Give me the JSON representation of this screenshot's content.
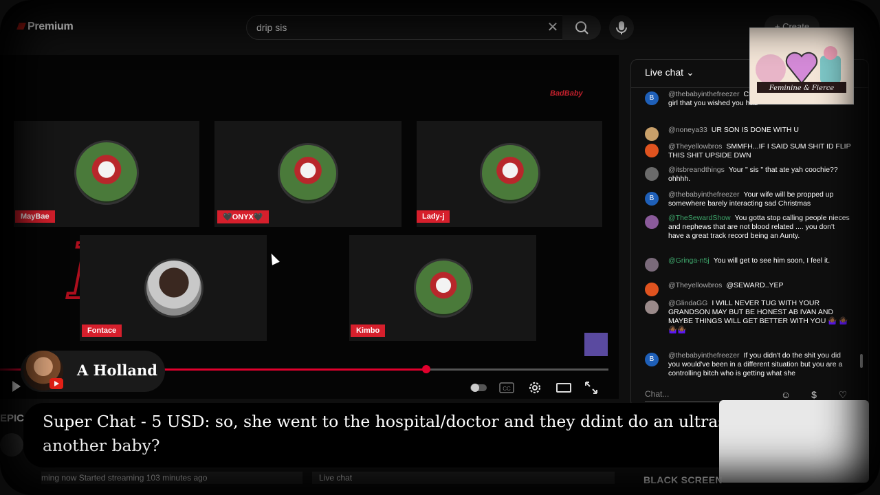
{
  "topbar": {
    "logo_label": "Premium",
    "search_value": "drip sis",
    "create_label": "+ Create"
  },
  "video": {
    "watermark": "BadBaby",
    "background_word": "Ba",
    "participants": [
      {
        "name": "MayBae"
      },
      {
        "name": "🖤ONYX🖤"
      },
      {
        "name": "Lady-j"
      },
      {
        "name": "Fontace"
      },
      {
        "name": "Kimbo"
      }
    ],
    "progress": 0.7
  },
  "channel": {
    "name": "A Holland"
  },
  "chat": {
    "header": "Live chat",
    "input_placeholder": "Chat...",
    "messages": [
      {
        "avatar": "B",
        "avatar_color": "#1e5fb8",
        "user": "@thebabyinthefreezer",
        "text": "Christmas with his beautiful baby girl that you wished you had",
        "verified": false
      },
      {
        "avatar": "",
        "avatar_color": "#c9a06a",
        "user": "@noneya33",
        "text": "UR SON IS DONE WITH U",
        "verified": false
      },
      {
        "avatar": "",
        "avatar_color": "#e0531f",
        "user": "@Theyellowbros",
        "text": "SMMFH...IF I SAID SUM SHIT ID FLIP THIS SHIT UPSIDE DWN",
        "verified": false
      },
      {
        "avatar": "",
        "avatar_color": "#6a6a6a",
        "user": "@itsbreandthings",
        "text": "Your \" sis \" that ate yah coochie?? ohhhh.",
        "verified": false
      },
      {
        "avatar": "B",
        "avatar_color": "#1e5fb8",
        "user": "@thebabyinthefreezer",
        "text": "Your wife will be propped up somewhere barely interacting sad Christmas",
        "verified": false
      },
      {
        "avatar": "",
        "avatar_color": "#8a5a9a",
        "user": "@TheSewardShow",
        "text": "You gotta stop calling people nieces and nephews that are not blood related .... you don't have a great track record being an Aunty.",
        "verified": true
      },
      {
        "avatar": "",
        "avatar_color": "#7a6a7a",
        "user": "@Gringa-n5j",
        "text": "You will get to see him soon, I feel it.",
        "verified": true
      },
      {
        "avatar": "",
        "avatar_color": "#e0531f",
        "user": "@Theyellowbros",
        "text": "@SEWARD..YEP",
        "verified": false
      },
      {
        "avatar": "",
        "avatar_color": "#9a8a8a",
        "user": "@GlindaGG",
        "text": "I WILL NEVER TUG WITH YOUR GRANDSON MAY BUT BE HONEST AB IVAN AND MAYBE THINGS WILL GET BETTER WITH YOU 🤷🏾‍♀️ 🤷🏾‍♀️🤷🏾‍♀️🤷🏾‍♀️",
        "verified": false
      },
      {
        "avatar": "B",
        "avatar_color": "#1e5fb8",
        "user": "@thebabyinthefreezer",
        "text": "If you didn't do the shit you did you would've been in a different situation but you are a controlling bitch who is getting what she",
        "verified": false
      }
    ]
  },
  "superchat": {
    "text": "Super Chat - 5 USD: so, she went to the hospital/doctor and they ddint do an ultrasound and see another baby?"
  },
  "epic_label": "EPIC",
  "bottom": {
    "status": "ming now  Started streaming 103 minutes ago",
    "live_chat_tab": "Live chat",
    "black_screen": "BLACK SCREEN"
  },
  "sticker": {
    "text": "Feminine & Fierce"
  },
  "colors": {
    "accent_red": "#d61f2c",
    "progress_red": "#e1002d"
  }
}
